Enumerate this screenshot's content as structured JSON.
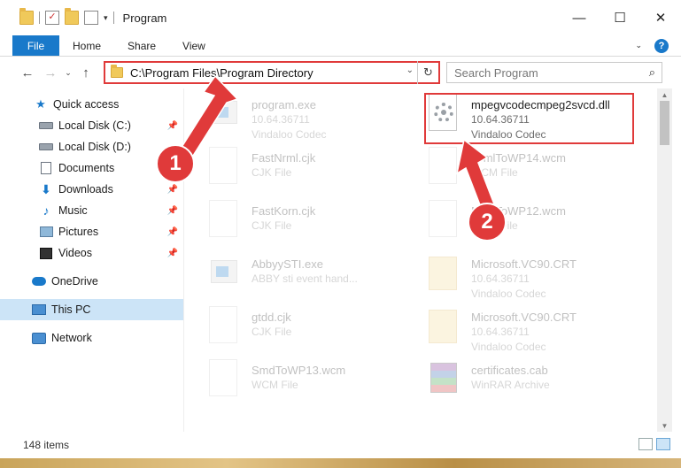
{
  "window": {
    "title": "Program",
    "controls": {
      "minimize": "—",
      "maximize": "☐",
      "close": "✕"
    }
  },
  "ribbon": {
    "tabs": [
      "File",
      "Home",
      "Share",
      "View"
    ]
  },
  "address": {
    "path": "C:\\Program Files\\Program Directory",
    "search_placeholder": "Search Program"
  },
  "sidebar": {
    "items": [
      {
        "label": "Quick access",
        "icon": "star-icon"
      },
      {
        "label": "Local Disk (C:)",
        "icon": "disk-icon",
        "pinned": true
      },
      {
        "label": "Local Disk (D:)",
        "icon": "disk-icon"
      },
      {
        "label": "Documents",
        "icon": "documents-icon",
        "pinned": true
      },
      {
        "label": "Downloads",
        "icon": "download-icon",
        "pinned": true
      },
      {
        "label": "Music",
        "icon": "music-icon",
        "pinned": true
      },
      {
        "label": "Pictures",
        "icon": "pictures-icon",
        "pinned": true
      },
      {
        "label": "Videos",
        "icon": "videos-icon",
        "pinned": true
      },
      {
        "label": "OneDrive",
        "icon": "cloud-icon"
      },
      {
        "label": "This PC",
        "icon": "computer-icon",
        "selected": true
      },
      {
        "label": "Network",
        "icon": "network-icon"
      }
    ]
  },
  "files": [
    {
      "name": "program.exe",
      "line2": "10.64.36711",
      "line3": "Vindaloo Codec",
      "icon": "exe-icon",
      "faded": true
    },
    {
      "name": "mpegvcodecmpeg2svcd.dll",
      "line2": "10.64.36711",
      "line3": "Vindaloo Codec",
      "icon": "dll-gear-icon",
      "faded": false
    },
    {
      "name": "FastNrml.cjk",
      "line2": "CJK File",
      "line3": "",
      "icon": "blank-file-icon",
      "faded": true
    },
    {
      "name": "NrmlToWP14.wcm",
      "line2": "WCM File",
      "line3": "",
      "icon": "blank-file-icon",
      "faded": true
    },
    {
      "name": "FastKorn.cjk",
      "line2": "CJK File",
      "line3": "",
      "icon": "blank-file-icon",
      "faded": true
    },
    {
      "name": "NrmlToWP12.wcm",
      "line2": "WCM File",
      "line3": "",
      "icon": "blank-file-icon",
      "faded": true
    },
    {
      "name": "AbbyySTI.exe",
      "line2": "ABBY sti event hand...",
      "line3": "",
      "icon": "exe-icon",
      "faded": true
    },
    {
      "name": "Microsoft.VC90.CRT",
      "line2": "10.64.36711",
      "line3": "Vindaloo Codec",
      "icon": "vc-folder-icon",
      "faded": true
    },
    {
      "name": "gtdd.cjk",
      "line2": "CJK File",
      "line3": "",
      "icon": "blank-file-icon",
      "faded": true
    },
    {
      "name": "Microsoft.VC90.CRT",
      "line2": "10.64.36711",
      "line3": "Vindaloo Codec",
      "icon": "vc-folder-icon",
      "faded": true
    },
    {
      "name": "SmdToWP13.wcm",
      "line2": "WCM File",
      "line3": "",
      "icon": "blank-file-icon",
      "faded": true
    },
    {
      "name": "certificates.cab",
      "line2": "WinRAR Archive",
      "line3": "",
      "icon": "rar-icon",
      "faded": true
    }
  ],
  "status": {
    "item_count": "148 items"
  },
  "annotations": {
    "step1": "1",
    "step2": "2",
    "color": "#e03a3a"
  }
}
